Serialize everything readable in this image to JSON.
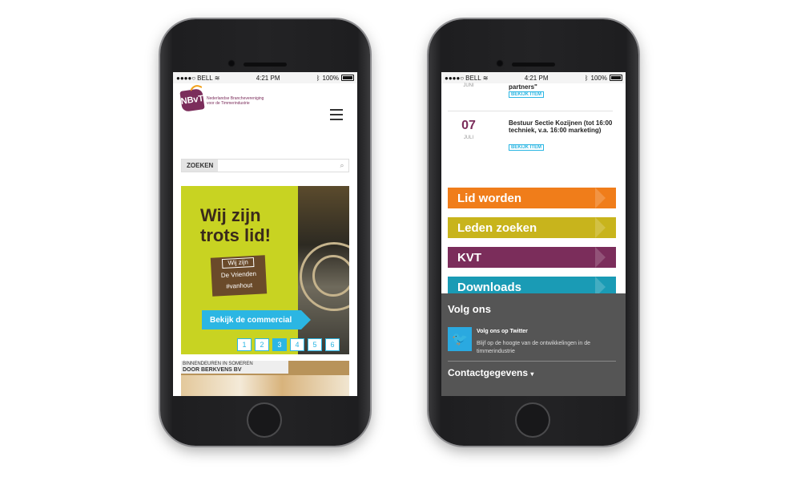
{
  "status": {
    "carrier": "BELL",
    "time": "4:21 PM",
    "battery": "100%"
  },
  "left": {
    "logo": {
      "text": "NBvT",
      "org": "Nederlandse Branchevereniging voor de Timmerindustrie"
    },
    "search": {
      "label": "ZOEKEN",
      "placeholder": ""
    },
    "hero": {
      "title": "Wij zijn trots lid!",
      "badge": [
        "Wij zijn",
        "De Vrienden",
        "#vanhout"
      ],
      "cta": "Bekijk de commercial",
      "pages": [
        "1",
        "2",
        "3",
        "4",
        "5",
        "6"
      ],
      "active_page": "3"
    },
    "item": {
      "caption": "BINNENDEUREN IN SOMEREN",
      "subtitle": "DOOR BERKVENS BV"
    }
  },
  "right": {
    "events": [
      {
        "day": "",
        "month": "JUNI",
        "title": "partners\"",
        "button": "BEKIJK ITEM"
      },
      {
        "day": "07",
        "month": "JULI",
        "title": "Bestuur Sectie Kozijnen (tot 16:00 techniek, v.a. 16:00 marketing)",
        "button": "BEKIJK ITEM"
      }
    ],
    "nav": [
      {
        "label": "Lid worden",
        "color": "#f07d1a"
      },
      {
        "label": "Leden zoeken",
        "color": "#c8b41c"
      },
      {
        "label": "KVT",
        "color": "#7b2d5b"
      },
      {
        "label": "Downloads",
        "color": "#1a9bb5"
      }
    ],
    "follow": {
      "heading": "Volg ons",
      "twitter_title": "Volg ons op Twitter",
      "twitter_desc": "Blijf op de hoogte van de ontwikkelingen in de timmerindustrie",
      "contact": "Contactgegevens"
    }
  }
}
